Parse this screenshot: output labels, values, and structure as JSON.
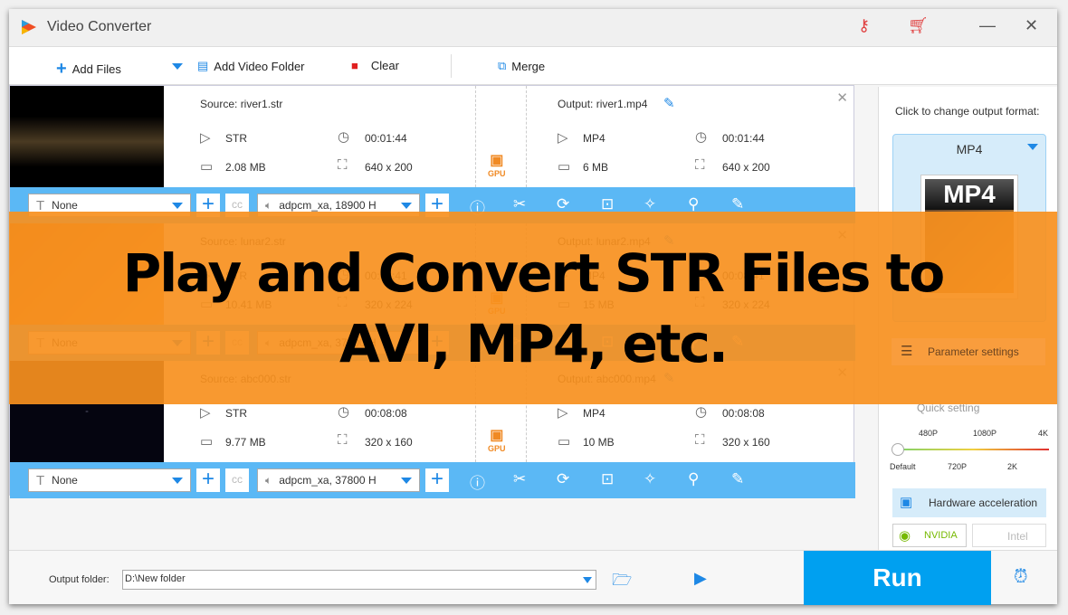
{
  "window": {
    "title": "Video Converter"
  },
  "toolbar": {
    "add_files": "Add Files",
    "add_folder": "Add Video Folder",
    "clear": "Clear",
    "merge": "Merge"
  },
  "rows": [
    {
      "source": "Source: river1.str",
      "src_format": "STR",
      "src_duration": "00:01:44",
      "src_size": "2.08 MB",
      "src_res": "640 x 200",
      "output": "Output: river1.mp4",
      "out_format": "MP4",
      "out_duration": "00:01:44",
      "out_size": "6 MB",
      "out_res": "640 x 200",
      "subtitle": "None",
      "audio": "adpcm_xa, 18900 H",
      "gpu": "GPU"
    },
    {
      "source": "Source: lunar2.str",
      "src_format": "STR",
      "src_duration": "00:08:41",
      "src_size": "10.41 MB",
      "src_res": "320 x 224",
      "output": "Output: lunar2.mp4",
      "out_format": "MP4",
      "out_duration": "00:08:41",
      "out_size": "15 MB",
      "out_res": "320 x 224",
      "subtitle": "None",
      "audio": "adpcm_xa, 37800 H",
      "gpu": "GPU"
    },
    {
      "source": "Source: abc000.str",
      "src_format": "STR",
      "src_duration": "00:08:08",
      "src_size": "9.77 MB",
      "src_res": "320 x 160",
      "output": "Output: abc000.mp4",
      "out_format": "MP4",
      "out_duration": "00:08:08",
      "out_size": "10 MB",
      "out_res": "320 x 160",
      "subtitle": "None",
      "audio": "adpcm_xa, 37800 H",
      "gpu": "GPU"
    }
  ],
  "right": {
    "hint": "Click to change output format:",
    "format": "MP4",
    "format_badge": "MP4",
    "param": "Parameter settings",
    "quick": "Quick setting",
    "ticks_top": [
      "480P",
      "1080P",
      "4K"
    ],
    "ticks_bottom": [
      "Default",
      "720P",
      "2K"
    ],
    "quality_level": 0,
    "hw": "Hardware acceleration",
    "nvidia": "NVIDIA",
    "intel": "Intel"
  },
  "bottom": {
    "label": "Output folder:",
    "path": "D:\\New folder",
    "run": "Run"
  },
  "overlay": {
    "line1": "Play and Convert STR Files to",
    "line2": "AVI, MP4, etc."
  },
  "colors": {
    "accent": "#00a0f0",
    "bar": "#5bb8f5",
    "overlay": "#f7901e"
  }
}
